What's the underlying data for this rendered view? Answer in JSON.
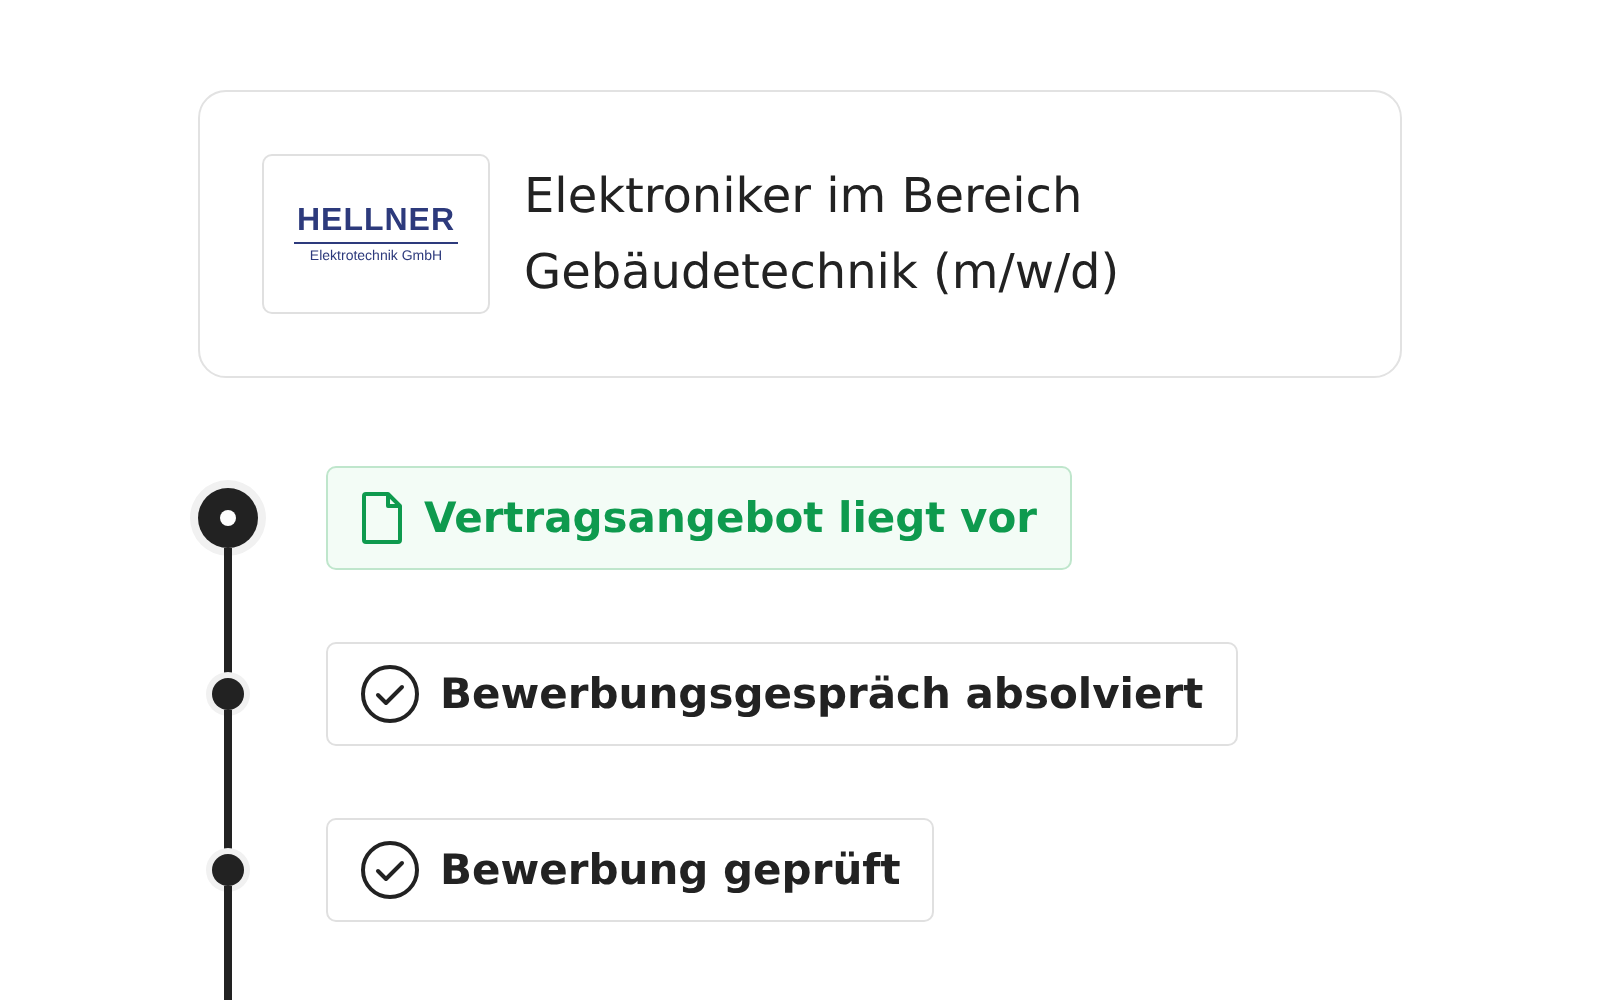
{
  "job": {
    "logo": {
      "name": "HELLNER",
      "subtitle": "Elektrotechnik GmbH"
    },
    "title_lines": [
      "Elektroniker im Bereich",
      "Gebäudetechnik (m/w/d)"
    ]
  },
  "steps": [
    {
      "label": "Vertragsangebot liegt vor",
      "current": true
    },
    {
      "label": "Bewerbungsgespräch absolviert",
      "current": false
    },
    {
      "label": "Bewerbung geprüft",
      "current": false
    }
  ]
}
